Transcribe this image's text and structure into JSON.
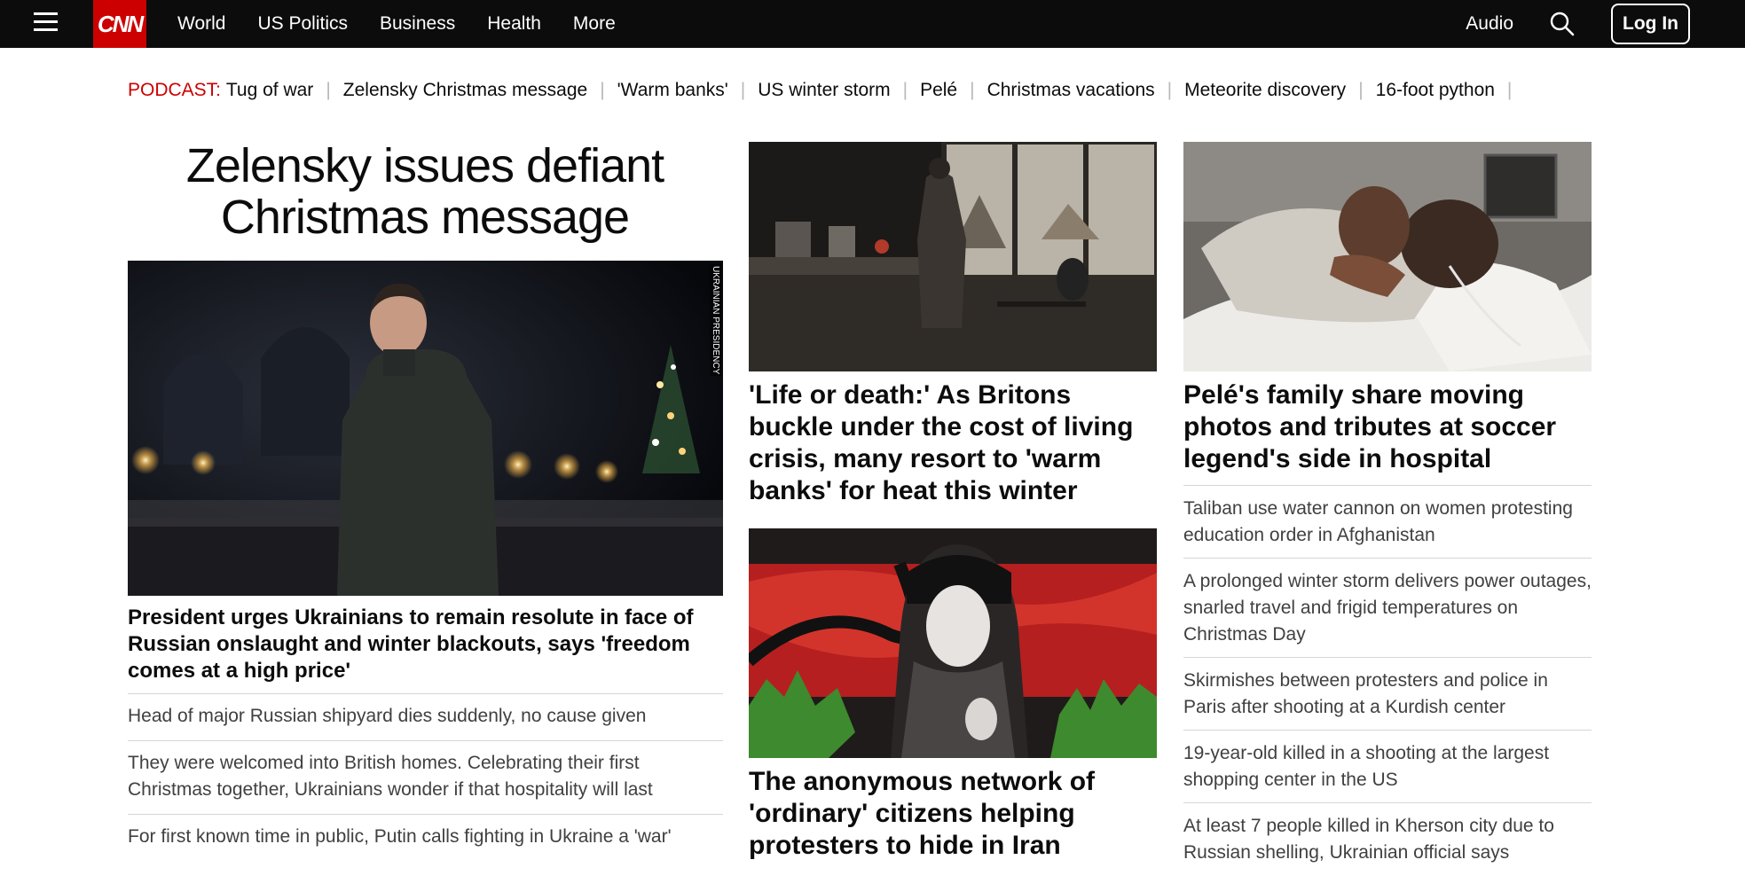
{
  "nav": {
    "logo": "CNN",
    "links": [
      "World",
      "US Politics",
      "Business",
      "Health",
      "More"
    ],
    "audio": "Audio",
    "login": "Log In"
  },
  "trending": {
    "label": "PODCAST:",
    "items": [
      "Tug of war",
      "Zelensky Christmas message",
      "'Warm banks'",
      "US winter storm",
      "Pelé",
      "Christmas vacations",
      "Meteorite discovery",
      "16-foot python"
    ]
  },
  "lead": {
    "title": "Zelensky issues defiant Christmas message",
    "image_credit": "UKRAINIAN PRESIDENCY",
    "headline": "President urges Ukrainians to remain resolute in face of Russian onslaught and winter blackouts, says 'freedom comes at a high price'",
    "list": [
      "Head of major Russian shipyard dies suddenly, no cause given",
      "They were welcomed into British homes. Celebrating their first Christmas together, Ukrainians wonder if that hospitality will last",
      "For first known time in public, Putin calls fighting in Ukraine a 'war'"
    ]
  },
  "middle": {
    "story1": "'Life or death:' As Britons buckle under the cost of living crisis, many resort to 'warm banks' for heat this winter",
    "story2": "The anonymous network of 'ordinary' citizens helping protesters to hide in Iran"
  },
  "right": {
    "headline": "Pelé's family share moving photos and tributes at soccer legend's side in hospital",
    "list": [
      "Taliban use water cannon on women protesting education order in Afghanistan",
      "A prolonged winter storm delivers power outages, snarled travel and frigid temperatures on Christmas Day",
      "Skirmishes between protesters and police in Paris after shooting at a Kurdish center",
      "19-year-old killed in a shooting at the largest shopping center in the US",
      "At least 7 people killed in Kherson city due to Russian shelling, Ukrainian official says"
    ]
  },
  "colors": {
    "brand_red": "#cc0000",
    "nav_bg": "#0c0c0c"
  },
  "icons": {
    "menu": "hamburger-menu-icon",
    "search": "search-icon"
  }
}
